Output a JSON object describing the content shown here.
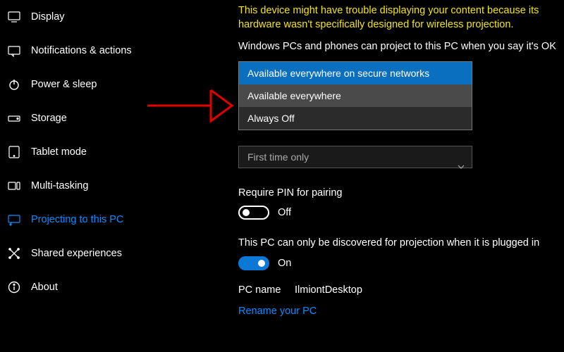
{
  "sidebar": {
    "items": [
      {
        "label": "Display",
        "icon": "display-icon",
        "active": false
      },
      {
        "label": "Notifications & actions",
        "icon": "notifications-icon",
        "active": false
      },
      {
        "label": "Power & sleep",
        "icon": "power-icon",
        "active": false
      },
      {
        "label": "Storage",
        "icon": "storage-icon",
        "active": false
      },
      {
        "label": "Tablet mode",
        "icon": "tablet-icon",
        "active": false
      },
      {
        "label": "Multi-tasking",
        "icon": "multitask-icon",
        "active": false
      },
      {
        "label": "Projecting to this PC",
        "icon": "projecting-icon",
        "active": true
      },
      {
        "label": "Shared experiences",
        "icon": "shared-icon",
        "active": false
      },
      {
        "label": "About",
        "icon": "about-icon",
        "active": false
      }
    ]
  },
  "main": {
    "warning": "This device might have trouble displaying your content because its hardware wasn't specifically designed for wireless projection.",
    "who_can_project_label": "Windows PCs and phones can project to this PC when you say it's OK",
    "dropdown": {
      "options": [
        "Available everywhere on secure networks",
        "Available everywhere",
        "Always Off"
      ],
      "selected_index": 0,
      "hovered_index": 1
    },
    "ask_dropdown_value": "First time only",
    "require_pin_label": "Require PIN for pairing",
    "require_pin_state": "Off",
    "discoverable_label": "This PC can only be discovered for projection when it is plugged in",
    "discoverable_state": "On",
    "pc_name_key": "PC name",
    "pc_name_value": "IlmiontDesktop",
    "rename_link": "Rename your PC"
  }
}
